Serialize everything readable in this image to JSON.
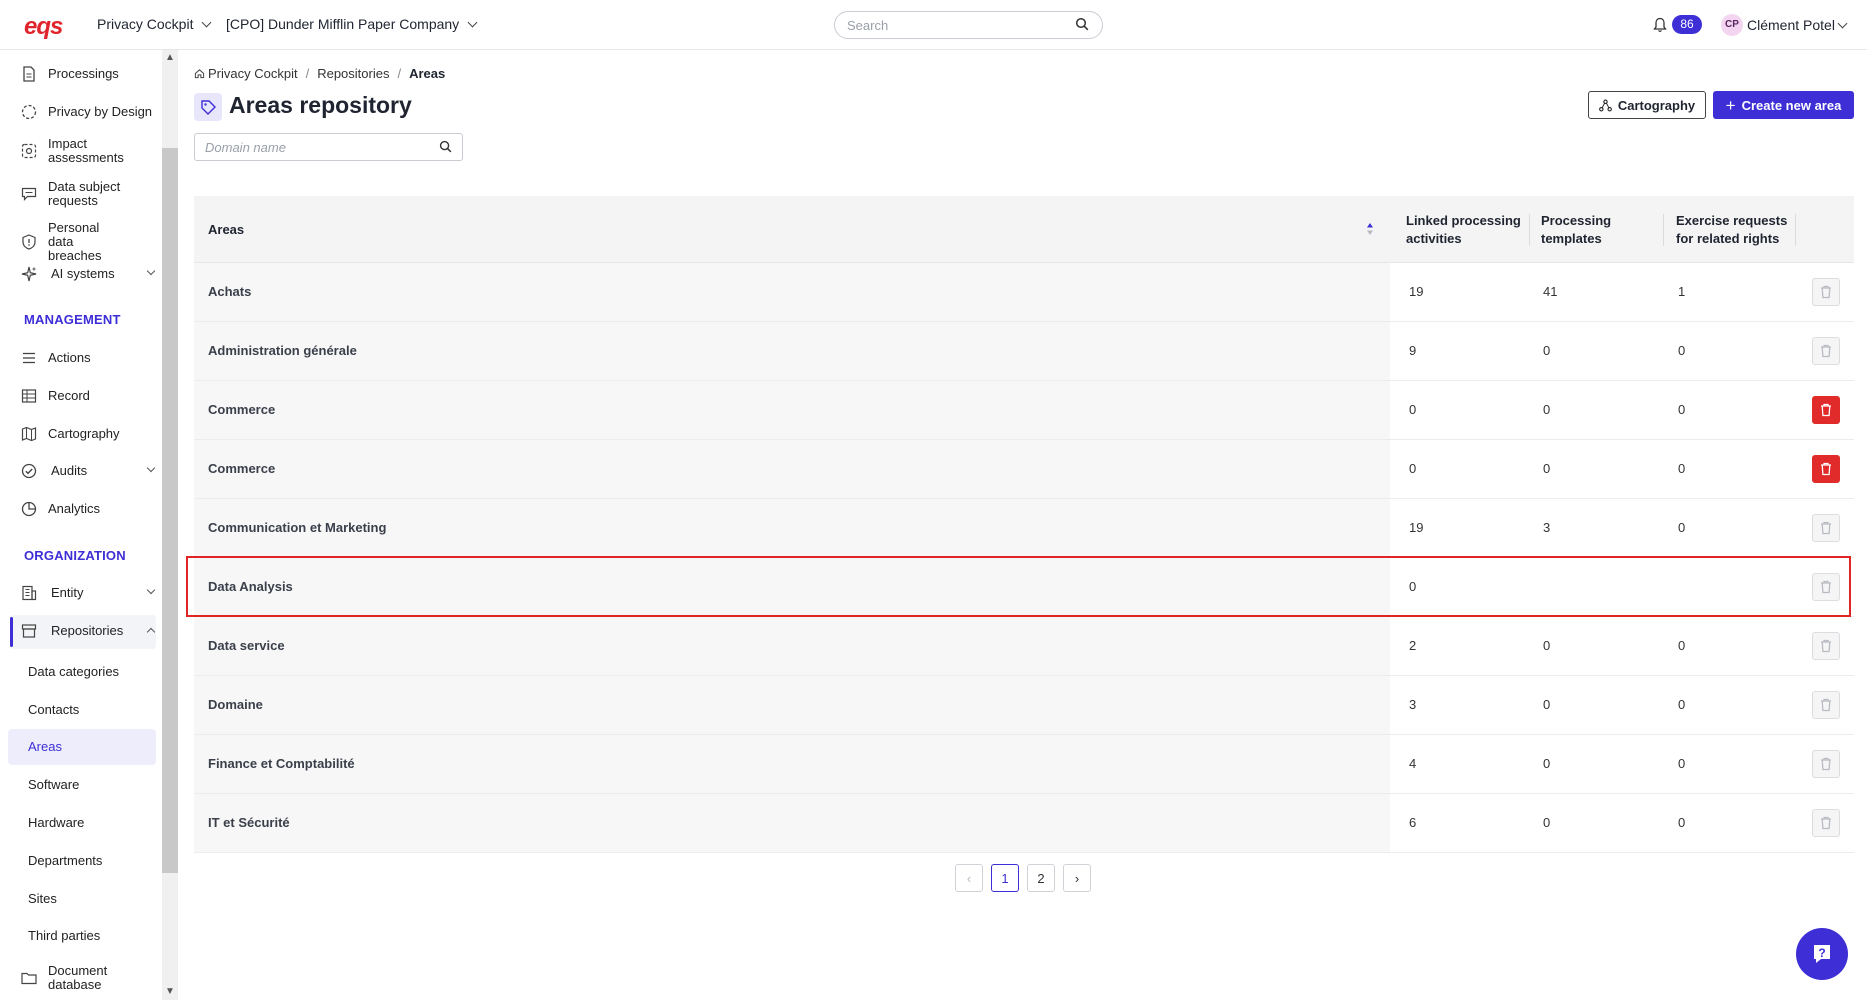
{
  "app": {
    "logo": "eqs",
    "module_menu": "Privacy Cockpit",
    "company_menu": "[CPO] Dunder Mifflin Paper Company",
    "search_placeholder": "Search",
    "notifications_count": "86",
    "user_initials": "CP",
    "user_name": "Clément Potel"
  },
  "sidebar": {
    "items": [
      {
        "label": "Processings",
        "icon": "document-icon"
      },
      {
        "label": "Privacy by Design",
        "icon": "design-icon"
      },
      {
        "label": "Impact assessments",
        "icon": "impact-icon"
      },
      {
        "label": "Data subject requests",
        "icon": "chat-icon"
      },
      {
        "label": "Personal data breaches",
        "icon": "shield-icon"
      },
      {
        "label": "AI systems",
        "icon": "sparkle-icon"
      }
    ],
    "management_title": "MANAGEMENT",
    "management": [
      {
        "label": "Actions",
        "icon": "list-icon"
      },
      {
        "label": "Record",
        "icon": "table-icon"
      },
      {
        "label": "Cartography",
        "icon": "map-icon"
      },
      {
        "label": "Audits",
        "icon": "check-circle-icon"
      },
      {
        "label": "Analytics",
        "icon": "pie-icon"
      }
    ],
    "organization_title": "ORGANIZATION",
    "organization": [
      {
        "label": "Entity",
        "icon": "building-icon"
      },
      {
        "label": "Repositories",
        "icon": "archive-icon"
      }
    ],
    "repositories_sub": [
      "Data categories",
      "Contacts",
      "Areas",
      "Software",
      "Hardware",
      "Departments",
      "Sites",
      "Third parties"
    ],
    "document_database": "Document database"
  },
  "breadcrumb": [
    "Privacy Cockpit",
    "Repositories",
    "Areas"
  ],
  "page": {
    "title": "Areas repository",
    "cartography_button": "Cartography",
    "create_button": "Create new area",
    "domain_placeholder": "Domain name"
  },
  "table": {
    "headers": {
      "areas": "Areas",
      "linked_1": "Linked processing",
      "linked_2": "activities",
      "templates_1": "Processing",
      "templates_2": "templates",
      "exercise_1": "Exercise requests",
      "exercise_2": "for related rights"
    },
    "rows": [
      {
        "name": "Achats",
        "linked": "19",
        "templates": "41",
        "exercise": "1",
        "deletable": false
      },
      {
        "name": "Administration générale",
        "linked": "9",
        "templates": "0",
        "exercise": "0",
        "deletable": false
      },
      {
        "name": "Commerce",
        "linked": "0",
        "templates": "0",
        "exercise": "0",
        "deletable": true
      },
      {
        "name": "Commerce",
        "linked": "0",
        "templates": "0",
        "exercise": "0",
        "deletable": true
      },
      {
        "name": "Communication et Marketing",
        "linked": "19",
        "templates": "3",
        "exercise": "0",
        "deletable": false
      },
      {
        "name": "Data Analysis",
        "linked": "0",
        "templates": "",
        "exercise": "",
        "deletable": false
      },
      {
        "name": "Data service",
        "linked": "2",
        "templates": "0",
        "exercise": "0",
        "deletable": false
      },
      {
        "name": "Domaine",
        "linked": "3",
        "templates": "0",
        "exercise": "0",
        "deletable": false
      },
      {
        "name": "Finance et Comptabilité",
        "linked": "4",
        "templates": "0",
        "exercise": "0",
        "deletable": false
      },
      {
        "name": "IT et Sécurité",
        "linked": "6",
        "templates": "0",
        "exercise": "0",
        "deletable": false
      }
    ]
  },
  "pagination": {
    "pages": [
      "1",
      "2"
    ],
    "current": "1"
  },
  "colors": {
    "accent": "#3d2ed6",
    "danger": "#e12b2b",
    "logo": "#e0242b"
  }
}
